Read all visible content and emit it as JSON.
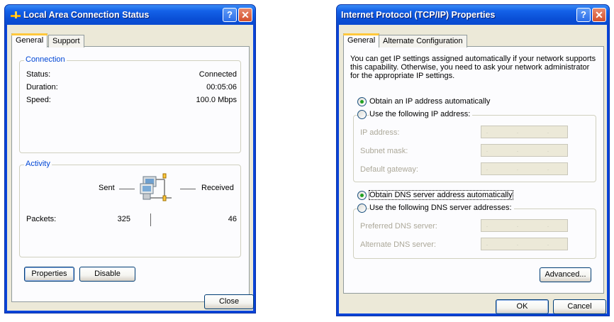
{
  "status_dialog": {
    "title": "Local Area Connection Status",
    "tabs": [
      "General",
      "Support"
    ],
    "connection": {
      "label": "Connection",
      "status_label": "Status:",
      "status_value": "Connected",
      "duration_label": "Duration:",
      "duration_value": "00:05:06",
      "speed_label": "Speed:",
      "speed_value": "100.0 Mbps"
    },
    "activity": {
      "label": "Activity",
      "sent_label": "Sent",
      "received_label": "Received",
      "packets_label": "Packets:",
      "packets_sent": "325",
      "packets_received": "46"
    },
    "properties_button": "Properties",
    "disable_button": "Disable",
    "close_button": "Close"
  },
  "tcpip_dialog": {
    "title": "Internet Protocol (TCP/IP) Properties",
    "tabs": [
      "General",
      "Alternate Configuration"
    ],
    "description": "You can get IP settings assigned automatically if your network supports this capability. Otherwise, you need to ask your network administrator for the appropriate IP settings.",
    "obtain_ip": "Obtain an IP address automatically",
    "use_ip": "Use the following IP address:",
    "ip_address_label": "IP address:",
    "subnet_label": "Subnet mask:",
    "gateway_label": "Default gateway:",
    "obtain_dns": "Obtain DNS server address automatically",
    "use_dns": "Use the following DNS server addresses:",
    "preferred_dns_label": "Preferred DNS server:",
    "alternate_dns_label": "Alternate DNS server:",
    "ip_placeholder": ". . .",
    "advanced_button": "Advanced...",
    "ok_button": "OK",
    "cancel_button": "Cancel"
  },
  "colors": {
    "titlebar": "#0a4fd6",
    "face": "#ece9d8",
    "group_label": "#0046d5"
  }
}
